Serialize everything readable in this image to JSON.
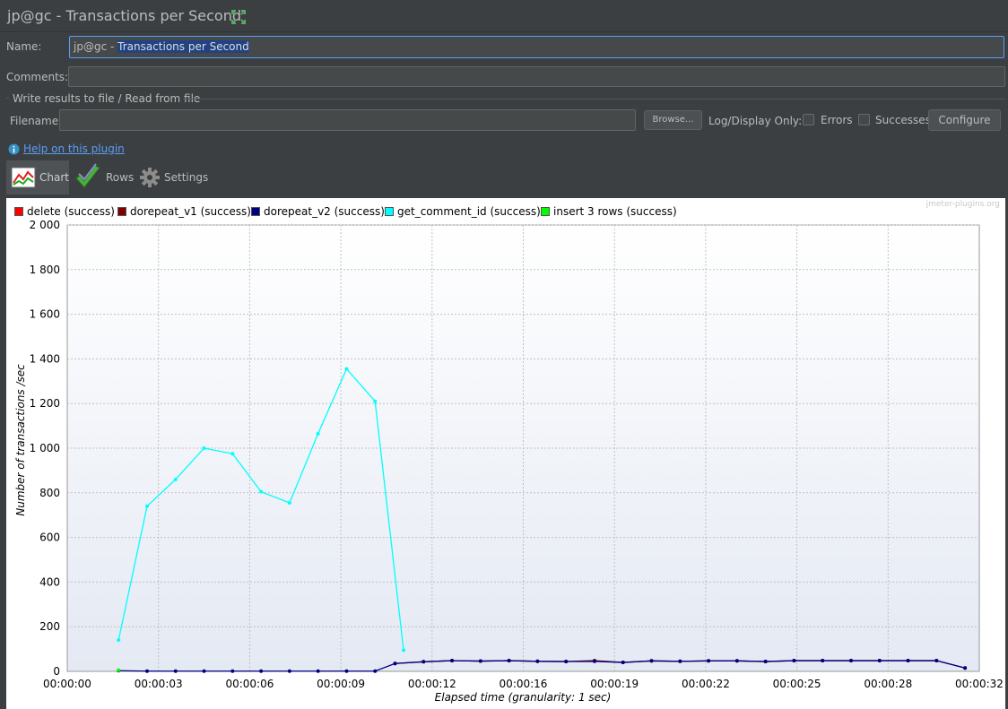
{
  "window": {
    "title": "jp@gc - Transactions per Second"
  },
  "form": {
    "name_label": "Name:",
    "name_prefix": "jp@gc - ",
    "name_selected": "Transactions per Second",
    "comments_label": "Comments:",
    "comments_value": "",
    "file_section_title": "Write results to file / Read from file",
    "filename_label": "Filename",
    "filename_value": "",
    "browse_label": "Browse...",
    "log_display_label": "Log/Display Only:",
    "errors_label": "Errors",
    "successes_label": "Successes",
    "configure_label": "Configure",
    "help_label": "Help on this plugin"
  },
  "tabs": [
    {
      "label": "Chart",
      "icon": "chart-icon",
      "active": true
    },
    {
      "label": "Rows",
      "icon": "checkmark-icon",
      "active": false
    },
    {
      "label": "Settings",
      "icon": "gear-icon",
      "active": false
    }
  ],
  "colors": {
    "accent": "#589df6",
    "delete": "#ff0000",
    "dorepeat_v1": "#800000",
    "dorepeat_v2": "#000080",
    "get_comment_id": "#00ffff",
    "insert_3_rows": "#00ff00"
  },
  "chart_data": {
    "type": "line",
    "watermark": "jmeter-plugins.org",
    "xlabel": "Elapsed time (granularity: 1 sec)",
    "ylabel": "Number of transactions /sec",
    "ylim": [
      0,
      2000
    ],
    "xlim_seconds": [
      0,
      32
    ],
    "y_ticks": [
      "0",
      "200",
      "400",
      "600",
      "800",
      "1 000",
      "1 200",
      "1 400",
      "1 600",
      "1 800",
      "2 000"
    ],
    "x_ticks": [
      "00:00:00",
      "00:00:03",
      "00:00:06",
      "00:00:09",
      "00:00:12",
      "00:00:16",
      "00:00:19",
      "00:00:22",
      "00:00:25",
      "00:00:28",
      "00:00:32"
    ],
    "grid": true,
    "legend_position": "top",
    "series": [
      {
        "name": "delete (success)",
        "color": "#ff0000",
        "x": [],
        "y": []
      },
      {
        "name": "dorepeat_v1 (success)",
        "color": "#800000",
        "x": [
          11.5,
          12.5,
          13.5,
          14.5,
          15.5,
          16.5,
          17.5,
          18.5,
          19.5,
          20.5,
          21.5,
          22.5,
          23.5,
          24.5,
          25.5,
          26.5,
          27.5,
          28.5,
          29.5,
          30.5,
          31.5
        ],
        "y": [
          35,
          43,
          48,
          46,
          48,
          45,
          44,
          48,
          40,
          47,
          45,
          47,
          47,
          44,
          48,
          48,
          48,
          48,
          48,
          48,
          15
        ]
      },
      {
        "name": "dorepeat_v2 (success)",
        "color": "#000080",
        "x": [
          1.8,
          2.8,
          3.8,
          4.8,
          5.8,
          6.8,
          7.8,
          8.8,
          9.8,
          10.8,
          11.5,
          12.5,
          13.5,
          14.5,
          15.5,
          16.5,
          17.5,
          18.5,
          19.5,
          20.5,
          21.5,
          22.5,
          23.5,
          24.5,
          25.5,
          26.5,
          27.5,
          28.5,
          29.5,
          30.5,
          31.5
        ],
        "y": [
          3,
          1,
          1,
          1,
          1,
          1,
          1,
          1,
          1,
          1,
          35,
          43,
          48,
          46,
          48,
          45,
          44,
          45,
          40,
          47,
          45,
          47,
          47,
          44,
          48,
          48,
          48,
          48,
          48,
          48,
          15
        ]
      },
      {
        "name": "get_comment_id (success)",
        "color": "#00ffff",
        "x": [
          1.8,
          2.8,
          3.8,
          4.8,
          5.8,
          6.8,
          7.8,
          8.8,
          9.8,
          10.8,
          11.8
        ],
        "y": [
          140,
          740,
          860,
          1000,
          975,
          805,
          755,
          1065,
          1355,
          1210,
          95
        ]
      },
      {
        "name": "insert 3 rows (success)",
        "color": "#00ff00",
        "x": [
          1.8
        ],
        "y": [
          5
        ]
      }
    ]
  }
}
